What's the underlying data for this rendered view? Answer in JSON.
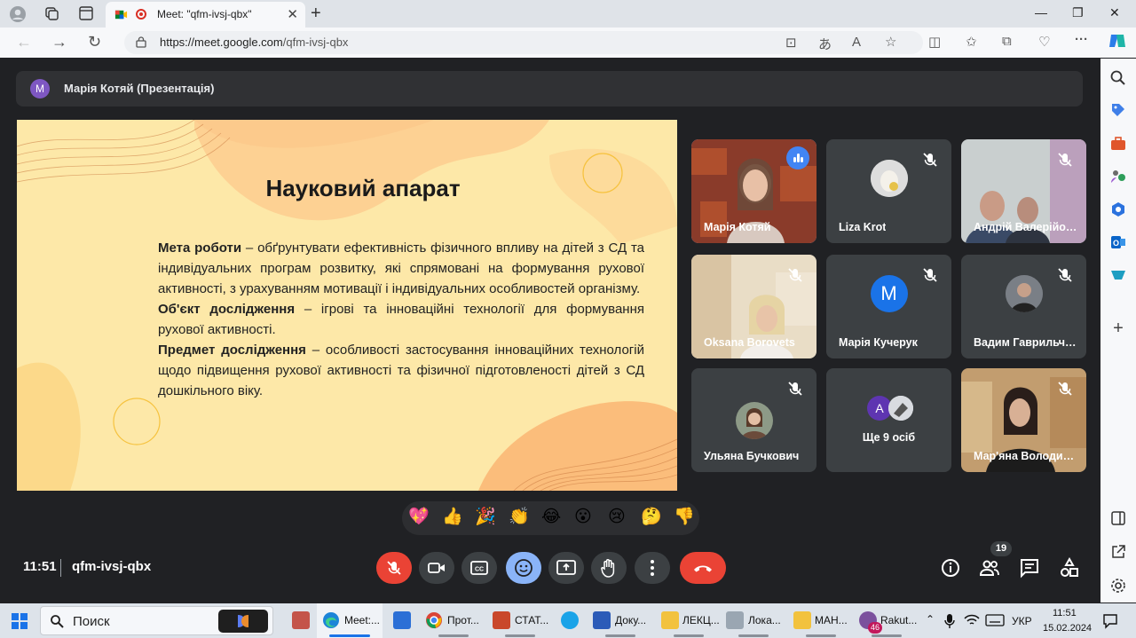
{
  "browser": {
    "tab_title": "Meet: \"qfm-ivsj-qbx\"",
    "url_host": "https://meet.google.com",
    "url_path": "/qfm-ivsj-qbx"
  },
  "meet": {
    "presenter_label": "Марія Котяй (Презентація)",
    "presenter_initial": "M",
    "slide": {
      "title": "Науковий апарат",
      "goal_heading": "Мета роботи",
      "goal_text": " – обґрунтувати ефективність фізичного впливу на дітей з СД та індивідуальних програм розвитку, які спрямовані на формування рухової активності, з урахуванням мотивації і індивідуальних особливостей організму.",
      "object_heading": "Об'єкт дослідження",
      "object_text": " – ігрові та інноваційні технології для формування рухової активності.",
      "subject_heading": "Предмет дослідження",
      "subject_text": " – особливості застосування інноваційних технологій щодо підвищення рухової активності та фізичної підготовленості дітей з СД дошкільного віку."
    },
    "participants": [
      {
        "name": "Марія Котяй"
      },
      {
        "name": "Liza Krot"
      },
      {
        "name": "Андрій Валерійович"
      },
      {
        "name": "Oksana Borovets"
      },
      {
        "name": "Марія Кучерук",
        "initial": "M"
      },
      {
        "name": "Вадим Гаврильченко"
      },
      {
        "name": "Ульяна Бучкович"
      },
      {
        "name": "Ще 9 осіб",
        "initial": "A"
      },
      {
        "name": "Мар'яна Володимирівна"
      }
    ],
    "reactions": [
      "💖",
      "👍",
      "🎉",
      "👏",
      "😂",
      "😮",
      "😢",
      "🤔",
      "👎"
    ],
    "time": "11:51",
    "meeting_code": "qfm-ivsj-qbx",
    "people_count": "19"
  },
  "taskbar": {
    "search_placeholder": "Поиск",
    "apps": [
      "Meet:...",
      "Прот...",
      "СТАТ...",
      "Доку...",
      "ЛЕКЦ...",
      "Лока...",
      "МАН...",
      "Rakut..."
    ],
    "viber_badge": "46",
    "language": "УКР",
    "clock_time": "11:51",
    "clock_date": "15.02.2024"
  },
  "colors": {
    "meet_bg": "#202124",
    "tile_bg": "#3c4043",
    "end_call": "#ea4335",
    "slide_bg": "#fde8a8",
    "accent": "#8ab4f8"
  }
}
